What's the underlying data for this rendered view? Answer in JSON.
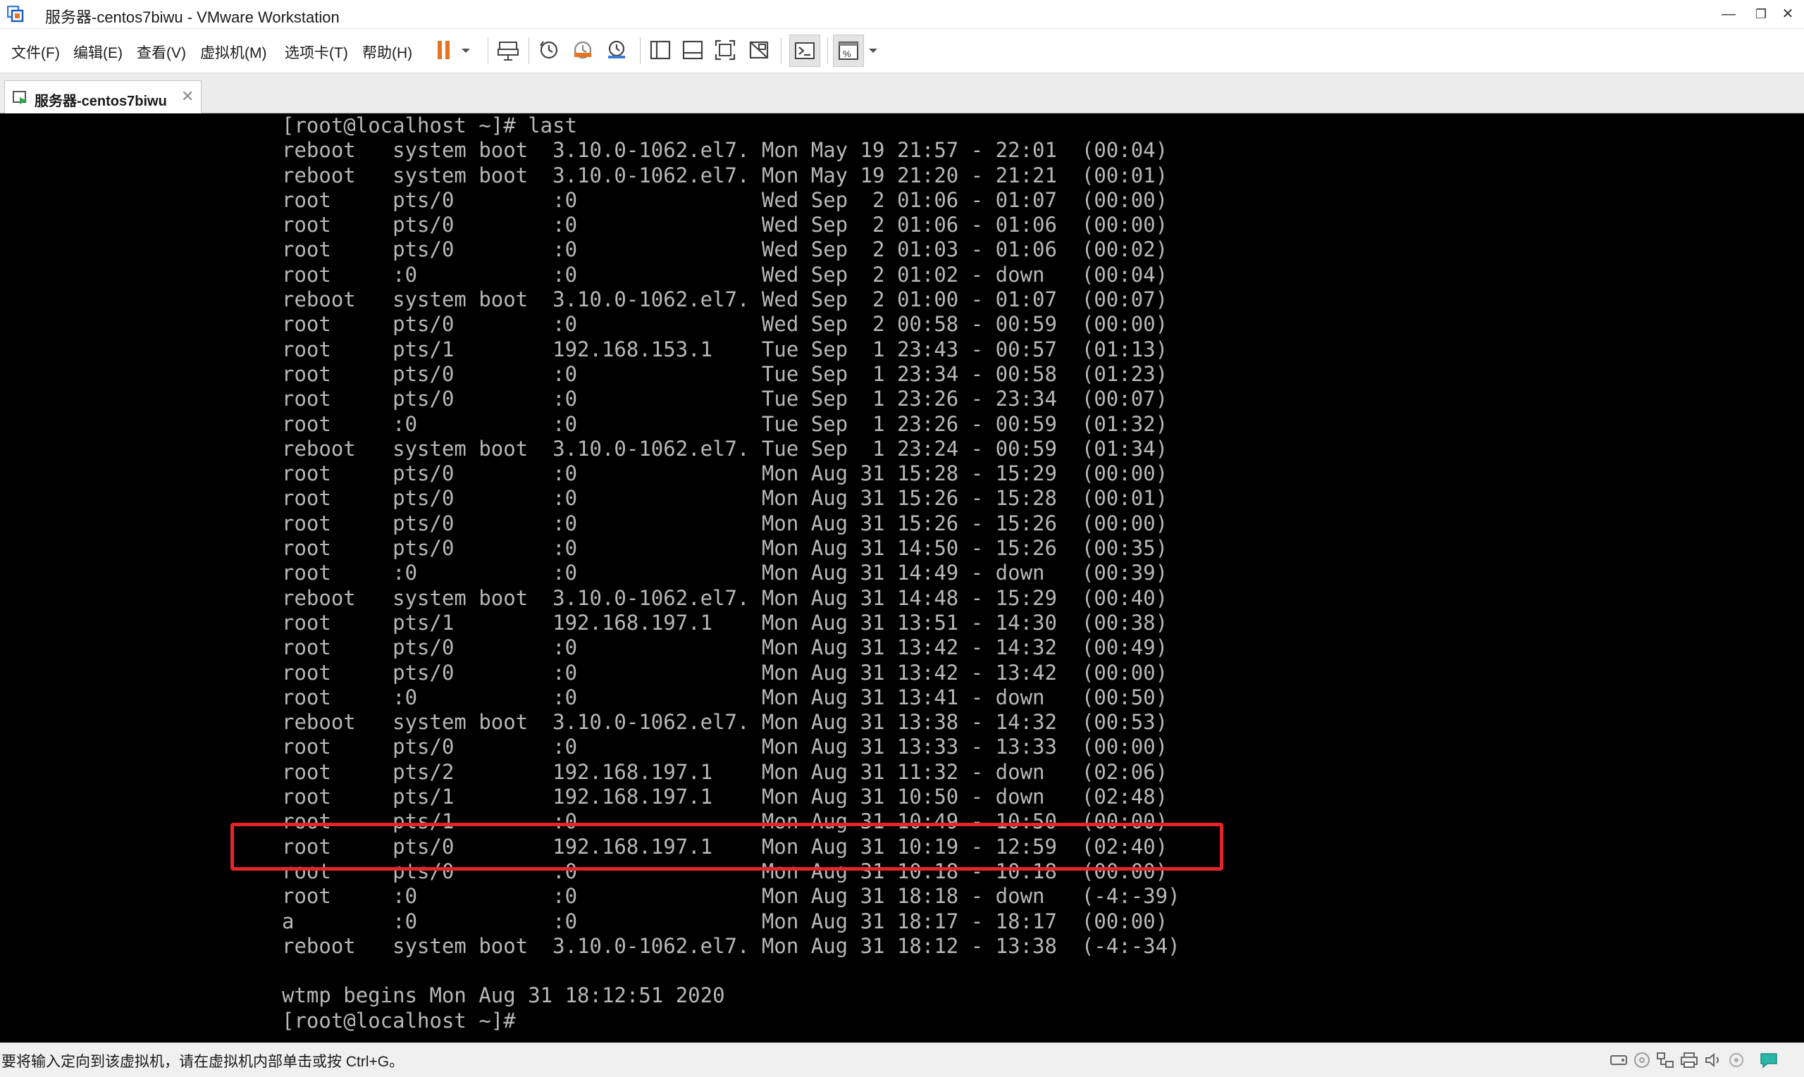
{
  "window": {
    "title": "服务器-centos7biwu - VMware Workstation",
    "controls": {
      "minimize": "—",
      "restore": "❐",
      "close": "✕"
    }
  },
  "menu": [
    "文件(F)",
    "编辑(E)",
    "查看(V)",
    "虚拟机(M)",
    "选项卡(T)",
    "帮助(H)"
  ],
  "toolbar": {
    "icons": [
      "pause-icon",
      "dropdown-icon",
      "send-ctrl-alt-del-icon",
      "snapshot-icon",
      "revert-snapshot-icon",
      "snapshot-manager-icon",
      "library-view-icon",
      "thumbnail-view-icon",
      "fullscreen-icon",
      "unity-icon",
      "console-icon",
      "stretch-icon",
      "dropdown-icon"
    ],
    "accent": "#e8731e"
  },
  "tab": {
    "label": "服务器-centos7biwu",
    "close": "✕"
  },
  "terminal": {
    "lines": [
      "[root@localhost ~]# last",
      "reboot   system boot  3.10.0-1062.el7. Mon May 19 21:57 - 22:01  (00:04)",
      "reboot   system boot  3.10.0-1062.el7. Mon May 19 21:20 - 21:21  (00:01)",
      "root     pts/0        :0               Wed Sep  2 01:06 - 01:07  (00:00)",
      "root     pts/0        :0               Wed Sep  2 01:06 - 01:06  (00:00)",
      "root     pts/0        :0               Wed Sep  2 01:03 - 01:06  (00:02)",
      "root     :0           :0               Wed Sep  2 01:02 - down   (00:04)",
      "reboot   system boot  3.10.0-1062.el7. Wed Sep  2 01:00 - 01:07  (00:07)",
      "root     pts/0        :0               Wed Sep  2 00:58 - 00:59  (00:00)",
      "root     pts/1        192.168.153.1    Tue Sep  1 23:43 - 00:57  (01:13)",
      "root     pts/0        :0               Tue Sep  1 23:34 - 00:58  (01:23)",
      "root     pts/0        :0               Tue Sep  1 23:26 - 23:34  (00:07)",
      "root     :0           :0               Tue Sep  1 23:26 - 00:59  (01:32)",
      "reboot   system boot  3.10.0-1062.el7. Tue Sep  1 23:24 - 00:59  (01:34)",
      "root     pts/0        :0               Mon Aug 31 15:28 - 15:29  (00:00)",
      "root     pts/0        :0               Mon Aug 31 15:26 - 15:28  (00:01)",
      "root     pts/0        :0               Mon Aug 31 15:26 - 15:26  (00:00)",
      "root     pts/0        :0               Mon Aug 31 14:50 - 15:26  (00:35)",
      "root     :0           :0               Mon Aug 31 14:49 - down   (00:39)",
      "reboot   system boot  3.10.0-1062.el7. Mon Aug 31 14:48 - 15:29  (00:40)",
      "root     pts/1        192.168.197.1    Mon Aug 31 13:51 - 14:30  (00:38)",
      "root     pts/0        :0               Mon Aug 31 13:42 - 14:32  (00:49)",
      "root     pts/0        :0               Mon Aug 31 13:42 - 13:42  (00:00)",
      "root     :0           :0               Mon Aug 31 13:41 - down   (00:50)",
      "reboot   system boot  3.10.0-1062.el7. Mon Aug 31 13:38 - 14:32  (00:53)",
      "root     pts/0        :0               Mon Aug 31 13:33 - 13:33  (00:00)",
      "root     pts/2        192.168.197.1    Mon Aug 31 11:32 - down   (02:06)",
      "root     pts/1        192.168.197.1    Mon Aug 31 10:50 - down   (02:48)",
      "root     pts/1        :0               Mon Aug 31 10:49 - 10:50  (00:00)",
      "root     pts/0        192.168.197.1    Mon Aug 31 10:19 - 12:59  (02:40)",
      "root     pts/0        :0               Mon Aug 31 10:18 - 10:18  (00:00)",
      "root     :0           :0               Mon Aug 31 18:18 - down   (-4:-39)",
      "a        :0           :0               Mon Aug 31 18:17 - 18:17  (00:00)",
      "reboot   system boot  3.10.0-1062.el7. Mon Aug 31 18:12 - 13:38  (-4:-34)",
      "",
      "wtmp begins Mon Aug 31 18:12:51 2020",
      "[root@localhost ~]#"
    ],
    "highlight_color": "#e8242b"
  },
  "status": {
    "text": "要将输入定向到该虚拟机，请在虚拟机内部单击或按 Ctrl+G。"
  },
  "status_icons": [
    "hard-disk-icon",
    "cd-dvd-icon",
    "network-icon",
    "printer-icon",
    "sound-icon",
    "usb-icon",
    "message-icon"
  ]
}
